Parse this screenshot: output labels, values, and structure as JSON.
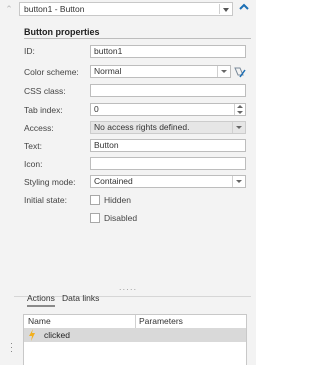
{
  "header": {
    "selected_component": "button1 - Button"
  },
  "section": {
    "title": "Button properties"
  },
  "properties": {
    "id": {
      "label": "ID:",
      "value": "button1"
    },
    "color_scheme": {
      "label": "Color scheme:",
      "value": "Normal"
    },
    "css_class": {
      "label": "CSS class:",
      "value": ""
    },
    "tab_index": {
      "label": "Tab index:",
      "value": "0"
    },
    "access": {
      "label": "Access:",
      "value": "No access rights defined."
    },
    "text": {
      "label": "Text:",
      "value": "Button"
    },
    "icon": {
      "label": "Icon:",
      "value": ""
    },
    "styling_mode": {
      "label": "Styling mode:",
      "value": "Contained"
    },
    "initial_state": {
      "label": "Initial state:",
      "hidden_label": "Hidden",
      "disabled_label": "Disabled",
      "hidden": false,
      "disabled": false
    }
  },
  "splitter": "·····",
  "tabs": [
    {
      "label": "Actions",
      "active": true
    },
    {
      "label": "Data links",
      "active": false
    }
  ],
  "grid": {
    "columns": [
      "Name",
      "Parameters"
    ],
    "rows": [
      {
        "name": "clicked",
        "parameters": "",
        "icon": "lightning-bolt-icon"
      }
    ]
  },
  "colors": {
    "accent": "#1c6fb5",
    "bolt": "#f2b01e",
    "selected_row": "#d9d9d9"
  }
}
